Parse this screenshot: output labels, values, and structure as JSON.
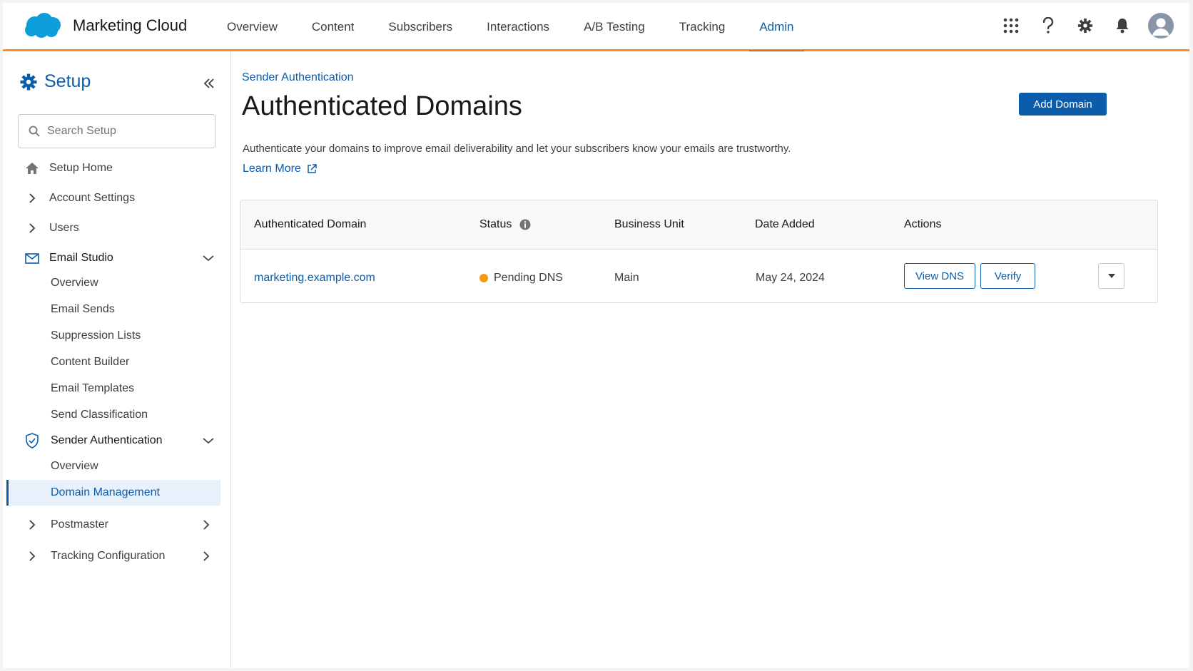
{
  "app": {
    "name": "Marketing Cloud",
    "brand_color": "#0b5cab",
    "accent_color": "#ff8a1f"
  },
  "topnav": {
    "tabs": [
      {
        "label": "Overview",
        "active": false
      },
      {
        "label": "Content",
        "active": false
      },
      {
        "label": "Subscribers",
        "active": false
      },
      {
        "label": "Interactions",
        "active": false
      },
      {
        "label": "A/B Testing",
        "active": false
      },
      {
        "label": "Tracking",
        "active": false
      },
      {
        "label": "Admin",
        "active": true
      }
    ],
    "icons": [
      "app-launcher-icon",
      "help-icon",
      "settings-icon",
      "notifications-bell-icon",
      "user-avatar-icon"
    ]
  },
  "sidebar": {
    "title": "Setup",
    "search_placeholder": "Search Setup",
    "items": [
      {
        "label": "Setup Home",
        "icon": "home-icon"
      },
      {
        "label": "Account Settings",
        "icon": "chevron-right-icon"
      },
      {
        "label": "Users",
        "icon": "chevron-right-icon"
      },
      {
        "label": "Email Studio",
        "icon": "envelope-icon",
        "expanded": true
      },
      {
        "label": "Overview"
      },
      {
        "label": "Email Sends"
      },
      {
        "label": "Suppression Lists"
      },
      {
        "label": "Content Builder"
      },
      {
        "label": "Email Templates"
      },
      {
        "label": "Send Classification"
      },
      {
        "label": "Sender Authentication",
        "icon": "shield-check-icon",
        "expanded": true
      },
      {
        "label": "Overview"
      },
      {
        "label": "Domain Management",
        "selected": true
      },
      {
        "label": "Postmaster",
        "icon": "chevron-right-icon"
      },
      {
        "label": "Tracking Configuration",
        "icon": "chevron-right-icon"
      }
    ]
  },
  "main": {
    "breadcrumb": "Sender Authentication",
    "title": "Authenticated Domains",
    "add_button": "Add Domain",
    "description": "Authenticate your domains to improve email deliverability and let your subscribers know your emails are trustworthy.",
    "learn_more": "Learn More",
    "table": {
      "columns": [
        "Authenticated Domain",
        "Status",
        "Business Unit",
        "Date Added",
        "Actions"
      ],
      "rows": [
        {
          "domain": "marketing.example.com",
          "status": "Pending DNS",
          "status_color": "#f59a0c",
          "business_unit": "Main",
          "date_added": "May 24, 2024",
          "actions": [
            "View DNS",
            "Verify"
          ]
        }
      ]
    }
  }
}
